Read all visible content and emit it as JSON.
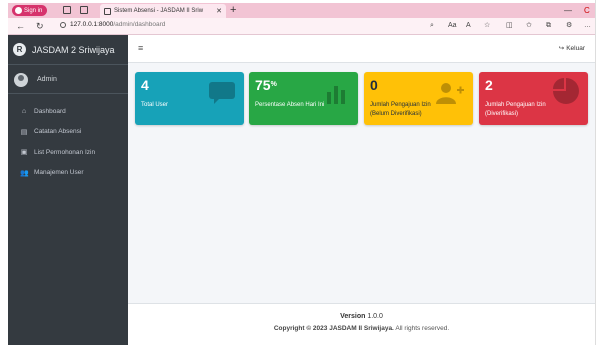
{
  "browser": {
    "profile_label": "Sign in",
    "tab_title": "Sistem Absensi - JASDAM II Sriw",
    "new_tab": "+",
    "url_host": "127.0.0.1:8000",
    "url_path": "/admin/dashboard",
    "read_aloud": "Aa"
  },
  "app": {
    "brand": "JASDAM 2 Sriwijaya",
    "brand_initial": "R",
    "user_name": "Admin",
    "menu": [
      {
        "label": "Dashboard",
        "icon": "home-icon"
      },
      {
        "label": "Catatan Absensi",
        "icon": "file-icon"
      },
      {
        "label": "List Permohonan Izin",
        "icon": "print-icon"
      },
      {
        "label": "Manajemen User",
        "icon": "users-icon"
      }
    ],
    "logout_label": "Keluar"
  },
  "cards": [
    {
      "value": "4",
      "suffix": "",
      "label_line1": "Total User",
      "label_line2": "",
      "color": "#17a2b8",
      "icon": "comment-icon"
    },
    {
      "value": "75",
      "suffix": "%",
      "label_line1": "Persentase Absen Hari Ini",
      "label_line2": "",
      "color": "#28a745",
      "icon": "bar-chart-icon"
    },
    {
      "value": "0",
      "suffix": "",
      "label_line1": "Jumlah Pengajuan Izin",
      "label_line2": "(Belum Diverifikasi)",
      "color": "#ffc107",
      "icon": "user-plus-icon"
    },
    {
      "value": "2",
      "suffix": "",
      "label_line1": "Jumlah Pengajuan Izin",
      "label_line2": "(Diverifikasi)",
      "color": "#dc3545",
      "icon": "pie-chart-icon"
    }
  ],
  "footer": {
    "version_label": "Version",
    "version_number": "1.0.0",
    "copyright_prefix": "Copyright © 2023",
    "copyright_org": "JASDAM II Sriwijaya.",
    "copyright_suffix": "All rights reserved."
  }
}
